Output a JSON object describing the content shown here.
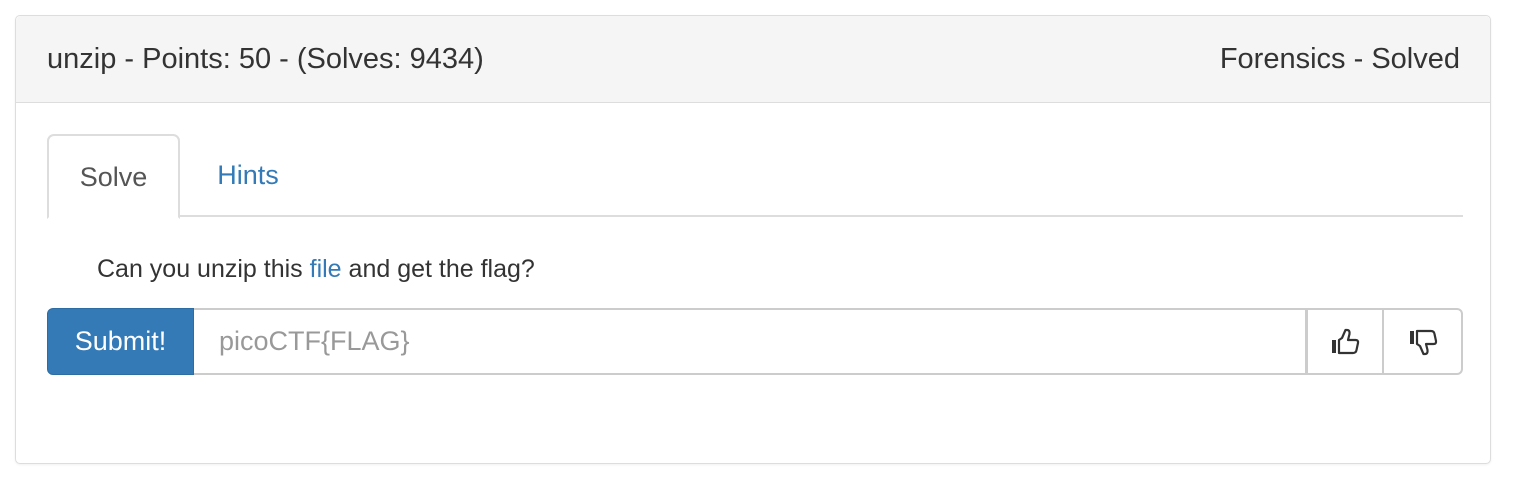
{
  "header": {
    "title": "unzip - Points: 50 - (Solves: 9434)",
    "status": "Forensics - Solved"
  },
  "tabs": [
    {
      "label": "Solve",
      "active": true
    },
    {
      "label": "Hints",
      "active": false
    }
  ],
  "description": {
    "before_link": "Can you unzip this ",
    "link_text": "file",
    "after_link": " and get the flag?"
  },
  "submit": {
    "button_label": "Submit!",
    "input_value": "",
    "input_placeholder": "picoCTF{FLAG}"
  },
  "votes": {
    "up_icon": "thumbs-up-icon",
    "down_icon": "thumbs-down-icon"
  },
  "colors": {
    "accent": "#337ab7",
    "heading_bg": "#f5f5f5",
    "border": "#dddddd"
  }
}
